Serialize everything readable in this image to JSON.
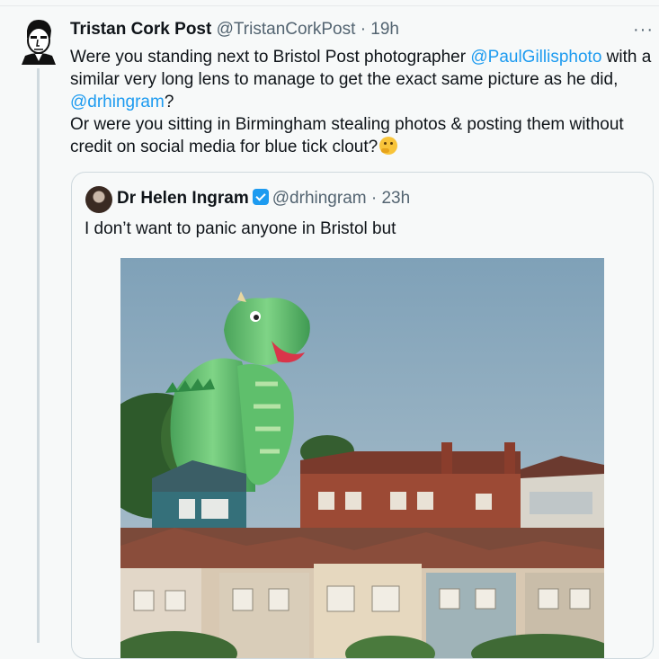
{
  "tweet": {
    "author_name": "Tristan Cork Post",
    "handle": "@TristanCorkPost",
    "separator": "·",
    "time": "19h",
    "text": {
      "p1_pre": "Were you standing next to Bristol Post photographer ",
      "p1_mention1": "@PaulGillisphoto",
      "p1_mid": " with a similar very long lens to manage to get the exact same picture as he did, ",
      "p1_mention2": "@drhingram",
      "p1_post": "?",
      "p2": "Or were you sitting in Birmingham stealing photos & posting them without credit on social media for blue tick clout?"
    },
    "more_icon": "···"
  },
  "quote": {
    "author_name": "Dr Helen Ingram",
    "handle": "@drhingram",
    "separator": "·",
    "time": "23h",
    "text": "I don’t want to panic anyone in Bristol but"
  },
  "colors": {
    "link": "#1d9bf0",
    "muted": "#536471",
    "background": "#f7f9f9"
  }
}
